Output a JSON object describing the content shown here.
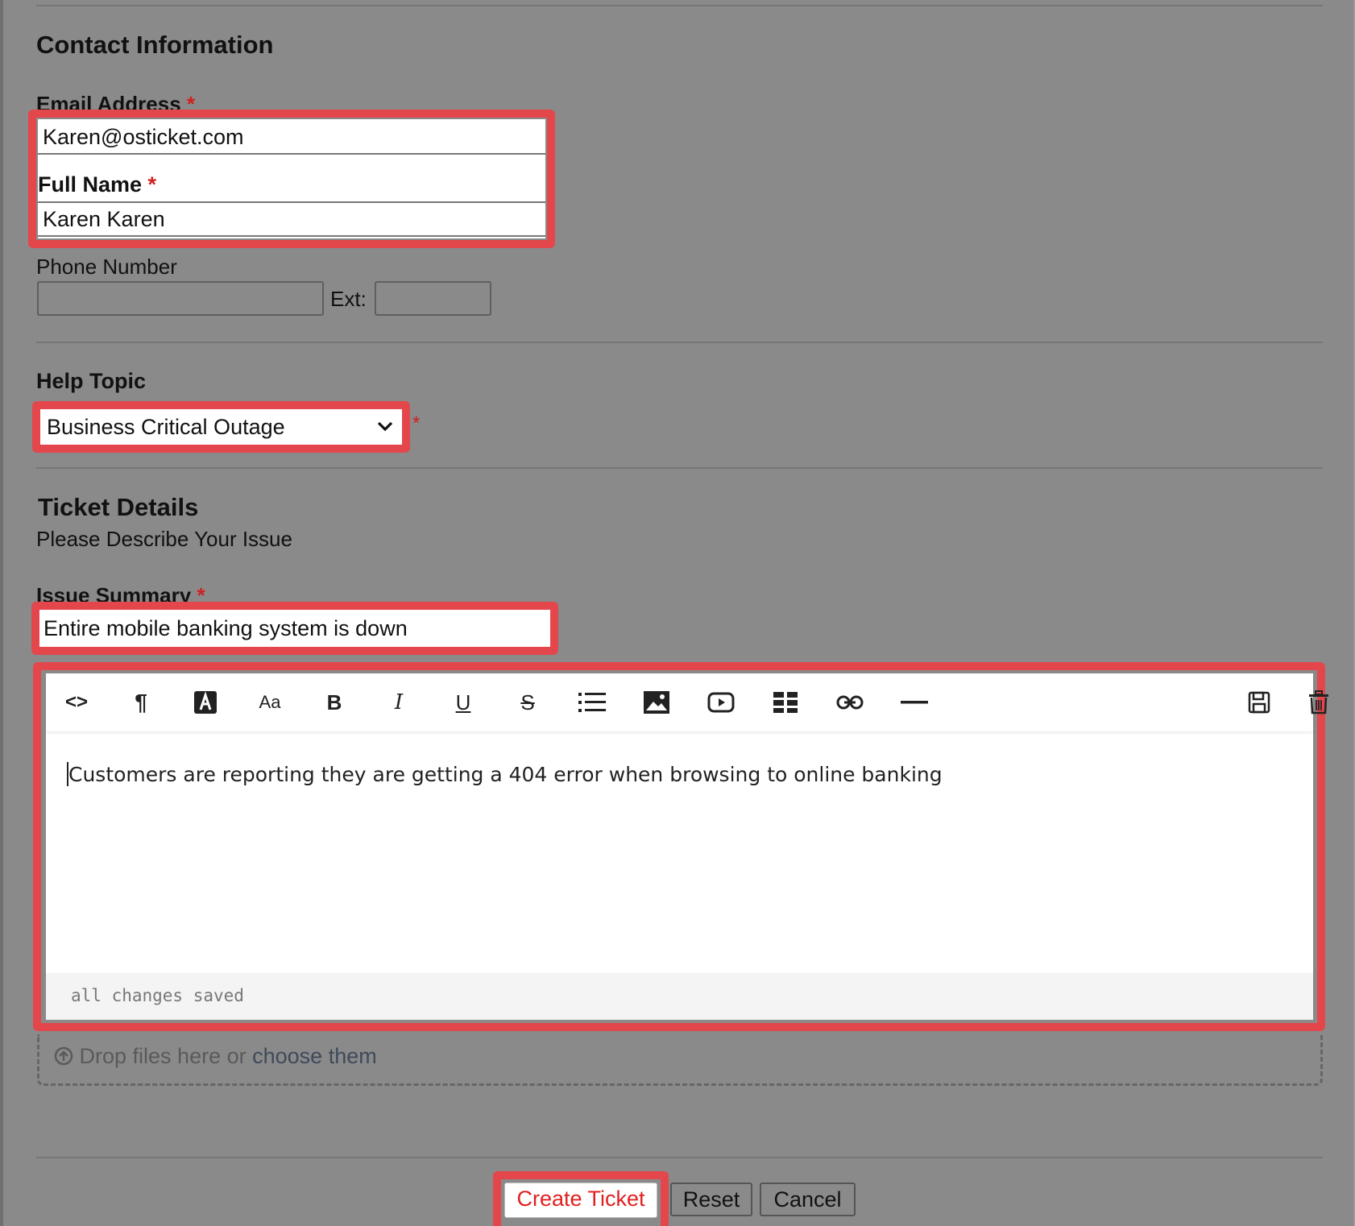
{
  "contact": {
    "heading": "Contact Information",
    "email_label": "Email Address",
    "email_value": "Karen@osticket.com",
    "name_label": "Full Name",
    "name_value": "Karen Karen",
    "phone_label": "Phone Number",
    "ext_label": "Ext:",
    "required_mark": "*"
  },
  "help_topic": {
    "heading": "Help Topic",
    "selected": "Business Critical Outage",
    "required_mark": "*"
  },
  "ticket": {
    "heading": "Ticket Details",
    "subheading": "Please Describe Your Issue",
    "summary_label": "Issue Summary",
    "summary_value": "Entire mobile banking system is down",
    "required_mark": "*"
  },
  "editor": {
    "toolbar": {
      "html": "<>",
      "paragraph": "¶",
      "bold": "B",
      "italic": "I",
      "underline": "U",
      "strike": "S",
      "fontsize": "Aa"
    },
    "body": "Customers are reporting they are getting a 404 error when browsing to online banking",
    "status": "all changes saved"
  },
  "dropzone": {
    "text": "Drop files here or",
    "link": "choose them"
  },
  "buttons": {
    "create": "Create Ticket",
    "reset": "Reset",
    "cancel": "Cancel"
  },
  "colors": {
    "highlight": "#e4474b",
    "background": "#8a8a8a",
    "create_text": "#e02020"
  }
}
